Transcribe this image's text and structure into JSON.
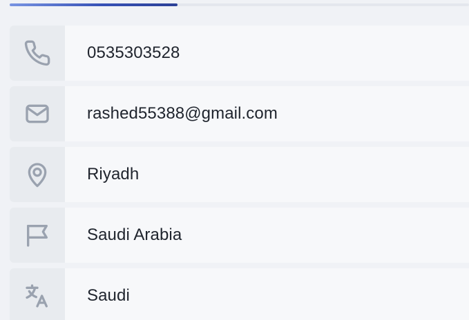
{
  "progress": {
    "fraction": 0.365,
    "fill_color": "#3651b6"
  },
  "contact": {
    "phone": {
      "icon": "phone-icon",
      "value": "0535303528"
    },
    "email": {
      "icon": "mail-icon",
      "value": "rashed55388@gmail.com"
    },
    "city": {
      "icon": "location-icon",
      "value": "Riyadh"
    },
    "country": {
      "icon": "flag-icon",
      "value": "Saudi Arabia"
    },
    "language": {
      "icon": "translate-icon",
      "value": "Saudi"
    }
  }
}
